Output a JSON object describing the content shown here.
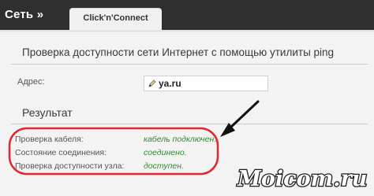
{
  "header": {
    "breadcrumb": "Сеть »",
    "tab_label": "Click'n'Connect"
  },
  "main": {
    "title": "Проверка доступности сети Интернет с помощью утилиты ping",
    "address": {
      "label": "Адрес:",
      "value": "ya.ru"
    },
    "result": {
      "title": "Результат",
      "rows": [
        {
          "label": "Проверка кабеля:",
          "value": "кабель подключен."
        },
        {
          "label": "Состояние соединения:",
          "value": "соединено."
        },
        {
          "label": "Проверка доступности узла:",
          "value": "доступен."
        }
      ]
    }
  },
  "annotations": {
    "highlight_color": "#e0282e",
    "arrow_color": "#111111"
  },
  "watermark": {
    "text": "Moicom.ru"
  },
  "colors": {
    "topbar": "#2f2f2f",
    "status_ok": "#2e8b2e"
  }
}
